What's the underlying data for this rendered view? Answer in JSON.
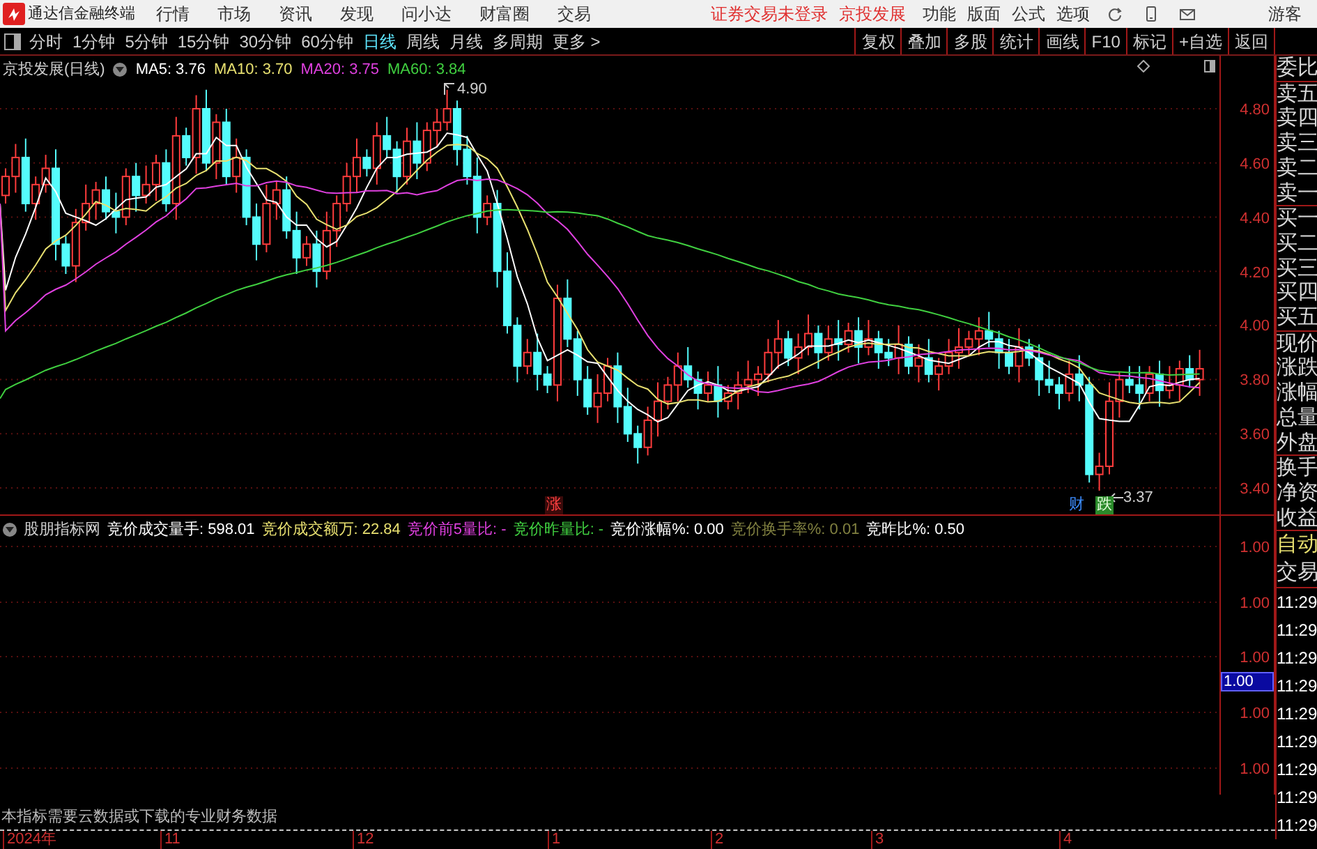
{
  "app_bar": {
    "title": "通达信金融终端",
    "menu": [
      "行情",
      "市场",
      "资讯",
      "发现",
      "问小达",
      "财富圈",
      "交易"
    ],
    "notices": [
      "证券交易未登录",
      "京投发展"
    ],
    "right_menu": [
      "功能",
      "版面",
      "公式",
      "选项"
    ],
    "user": "游客"
  },
  "period_tabs": [
    {
      "label": "分时",
      "selected": false
    },
    {
      "label": "1分钟",
      "selected": false
    },
    {
      "label": "5分钟",
      "selected": false
    },
    {
      "label": "15分钟",
      "selected": false
    },
    {
      "label": "30分钟",
      "selected": false
    },
    {
      "label": "60分钟",
      "selected": false
    },
    {
      "label": "日线",
      "selected": true
    },
    {
      "label": "周线",
      "selected": false
    },
    {
      "label": "月线",
      "selected": false
    },
    {
      "label": "多周期",
      "selected": false
    },
    {
      "label": "更多 >",
      "selected": false
    }
  ],
  "tools": [
    "复权",
    "叠加",
    "多股",
    "统计",
    "画线",
    "F10",
    "标记",
    "+自选",
    "返回"
  ],
  "price_chart": {
    "title": "京投发展(日线)",
    "ma": [
      {
        "label": "MA5: 3.76",
        "color": "#ffffff"
      },
      {
        "label": "MA10: 3.70",
        "color": "#e8e070"
      },
      {
        "label": "MA20: 3.75",
        "color": "#e040e0"
      },
      {
        "label": "MA60: 3.84",
        "color": "#40d040"
      }
    ],
    "yaxis": [
      "4.80",
      "4.60",
      "4.40",
      "4.20",
      "4.00",
      "3.80",
      "3.60",
      "3.40"
    ],
    "high_label": "4.90",
    "low_label": "3.37",
    "badges": [
      {
        "text": "涨",
        "kind": "up"
      },
      {
        "text": "财",
        "kind": "finance"
      },
      {
        "text": "跌",
        "kind": "down"
      }
    ]
  },
  "indicator": {
    "name": "股朋指标网",
    "fields": [
      {
        "text": "竞价成交量手: 598.01",
        "color": "#ffffff"
      },
      {
        "text": "竞价成交额万: 22.84",
        "color": "#e8e070"
      },
      {
        "text": "竞价前5量比: -",
        "color": "#e040e0"
      },
      {
        "text": "竞价昨量比: -",
        "color": "#40d040"
      },
      {
        "text": "竞价涨幅%: 0.00",
        "color": "#ffffff"
      },
      {
        "text": "竞价换手率%: 0.01",
        "color": "#808040"
      },
      {
        "text": "竞昨比%: 0.50",
        "color": "#ffffff"
      }
    ],
    "yaxis": [
      "1.00",
      "1.00",
      "1.00",
      "1.00",
      "1.00"
    ],
    "cursor_value": "1.00",
    "notice": "本指标需要云数据或下载的专业财务数据"
  },
  "dates": [
    "2024年",
    "11",
    "12",
    "1",
    "2",
    "3",
    "4"
  ],
  "quote_panel": {
    "groups": [
      [
        "委比"
      ],
      [
        "卖五",
        "卖四",
        "卖三",
        "卖二",
        "卖一"
      ],
      [
        "买一",
        "买二",
        "买三",
        "买四",
        "买五"
      ],
      [
        "现价",
        "涨跌",
        "涨幅",
        "总量",
        "外盘"
      ],
      [
        "换手",
        "净资",
        "收益"
      ]
    ],
    "auto": "自动",
    "trade": "交易",
    "times": [
      "11:29",
      "11:29",
      "11:29",
      "11:29",
      "11:29",
      "11:29",
      "11:29",
      "11:29",
      "11:29"
    ]
  }
}
